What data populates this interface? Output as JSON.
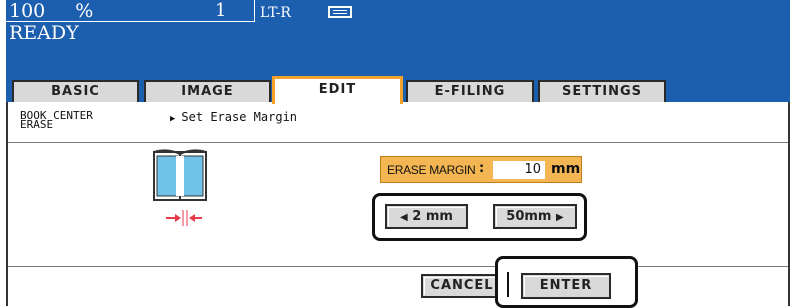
{
  "status": {
    "copies": "100",
    "copies_unit": "%",
    "originals": "1",
    "paper_size": "LT-R",
    "tray_icon": "paper-tray-icon",
    "state": "READY"
  },
  "tabs": [
    {
      "label": "BASIC"
    },
    {
      "label": "IMAGE"
    },
    {
      "label": "EDIT",
      "active": true
    },
    {
      "label": "E-FILING"
    },
    {
      "label": "SETTINGS"
    }
  ],
  "function": {
    "line1": "BOOK CENTER",
    "line2": "ERASE",
    "instruction": "Set Erase Margin"
  },
  "erase_margin": {
    "label": "ERASE MARGIN",
    "colon": ":",
    "value": "10",
    "unit": "mm",
    "decrement_label": "2 mm",
    "increment_label": "50mm"
  },
  "footer": {
    "cancel_label": "CANCEL",
    "enter_label": "ENTER"
  },
  "colors": {
    "header_blue": "#1c5fae",
    "active_tab_border": "#f3a22a",
    "margin_display_bg": "#f4b652",
    "button_gray": "#d9d9d9",
    "arrow_red": "#e8394a",
    "book_blue": "#6fc3e8"
  }
}
